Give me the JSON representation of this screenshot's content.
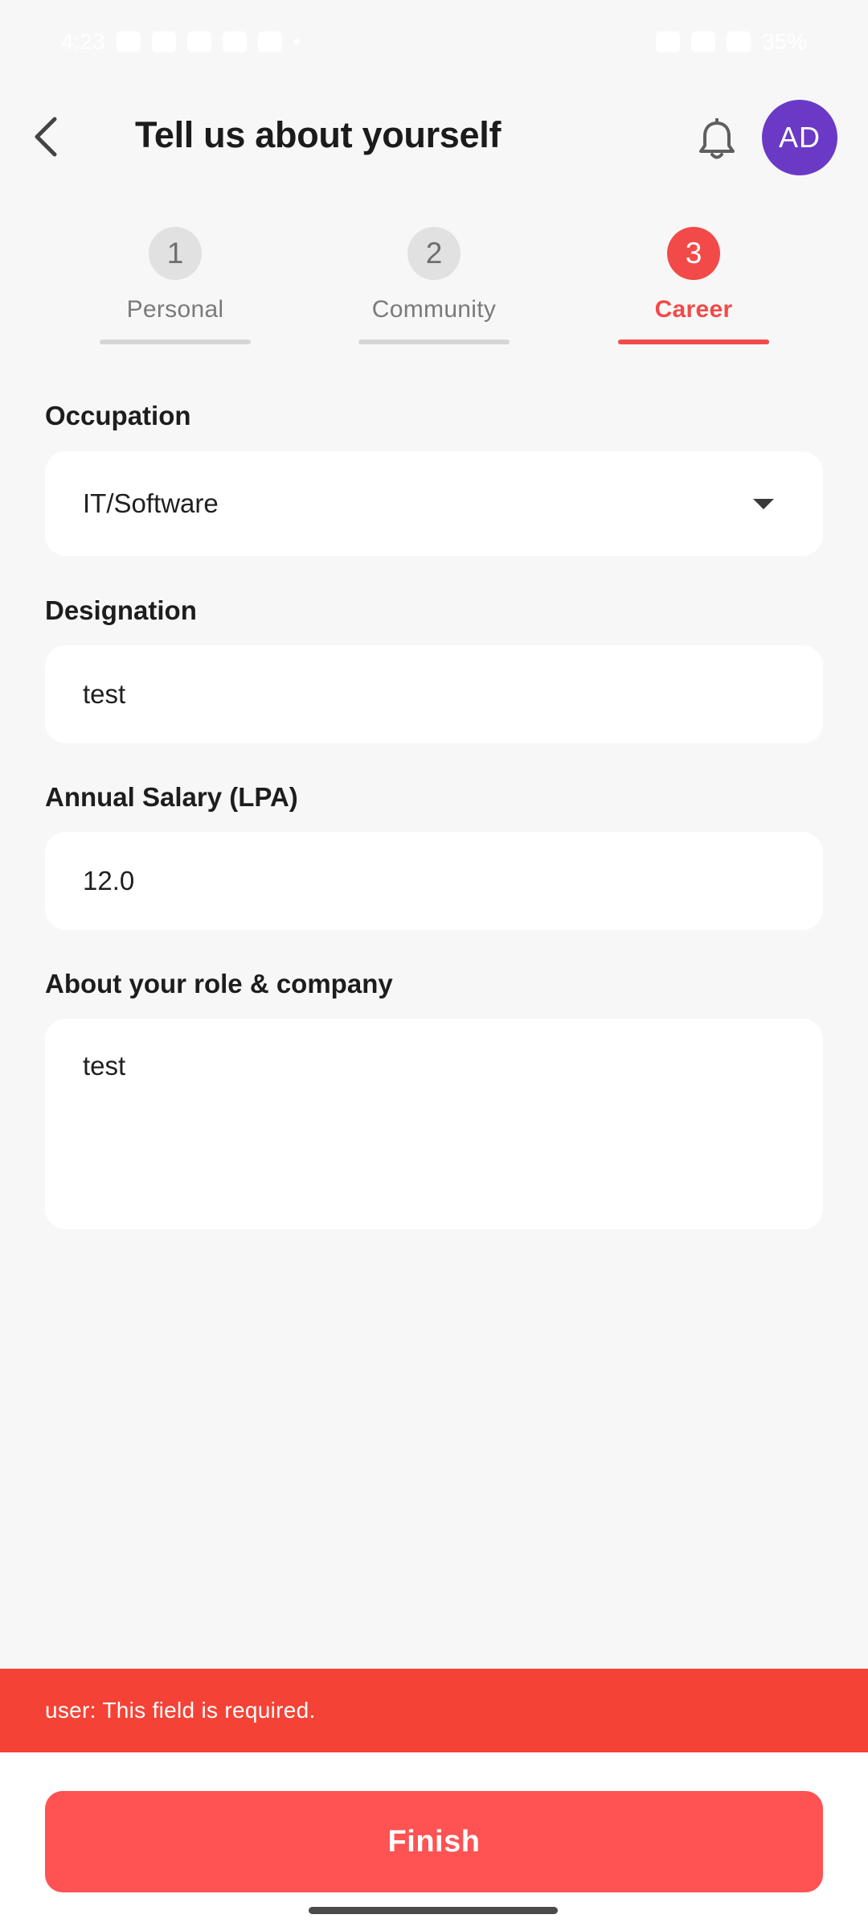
{
  "status_bar": {
    "time": "4:23",
    "battery": "35%"
  },
  "header": {
    "title": "Tell us about yourself",
    "avatar_initials": "AD"
  },
  "steps": [
    {
      "number": "1",
      "label": "Personal"
    },
    {
      "number": "2",
      "label": "Community"
    },
    {
      "number": "3",
      "label": "Career"
    }
  ],
  "active_step": 3,
  "form": {
    "occupation": {
      "label": "Occupation",
      "value": "IT/Software"
    },
    "designation": {
      "label": "Designation",
      "value": "test"
    },
    "salary": {
      "label": "Annual Salary (LPA)",
      "value": "12.0"
    },
    "about": {
      "label": "About your role & company",
      "value": "test"
    }
  },
  "snackbar": {
    "message": "user: This field is required."
  },
  "actions": {
    "finish_label": "Finish"
  },
  "colors": {
    "accent": "#f24a48",
    "finish_button": "#ff5252",
    "snackbar": "#f44336",
    "avatar": "#6a3ac6",
    "background": "#f7f7f7"
  },
  "icons": {
    "back": "chevron-left-icon",
    "notifications": "bell-icon",
    "dropdown": "caret-down-icon"
  }
}
